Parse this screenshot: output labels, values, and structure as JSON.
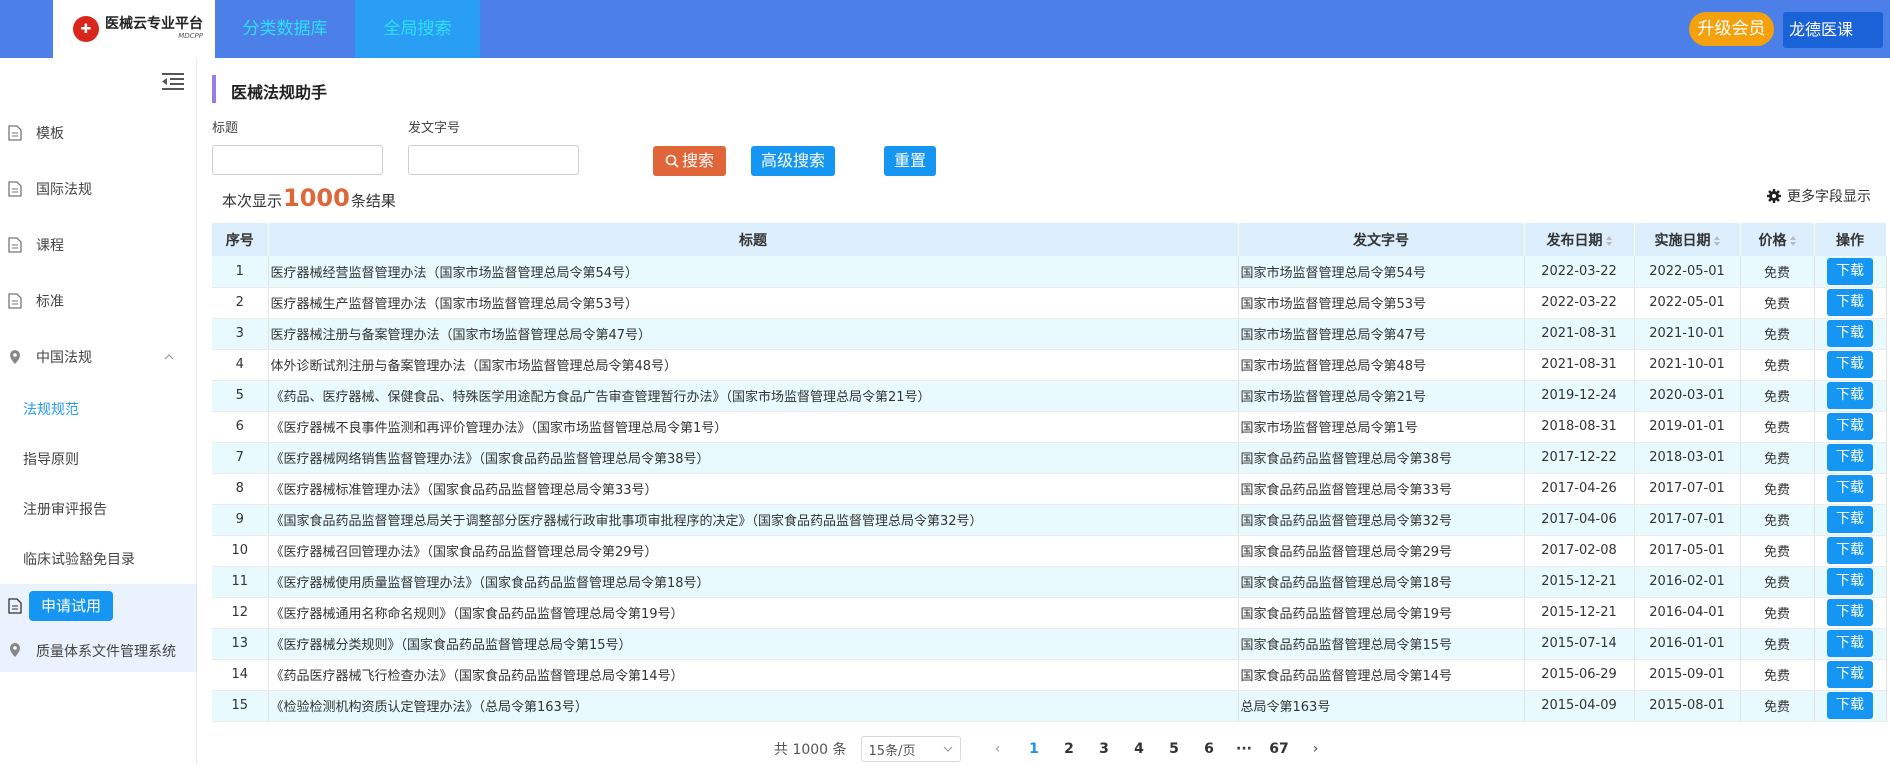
{
  "header": {
    "logo_title": "医械云专业平台",
    "logo_sub": "MDCPP",
    "tabs": [
      {
        "label": "分类数据库"
      },
      {
        "label": "全局搜索"
      }
    ],
    "upgrade_label": "升级会员",
    "user_name": "龙德医课",
    "colors": {
      "bar": "#4c7fe8",
      "tab_text": "#2ee0f6",
      "active_tab": "#2a9df4",
      "upgrade": "#f5a10d"
    }
  },
  "sidebar": {
    "items": [
      {
        "label": "模板",
        "icon": "document-icon"
      },
      {
        "label": "国际法规",
        "icon": "document-icon"
      },
      {
        "label": "课程",
        "icon": "document-icon"
      },
      {
        "label": "标准",
        "icon": "document-icon"
      },
      {
        "label": "中国法规",
        "icon": "location-pin-icon",
        "expanded": true
      }
    ],
    "sub_items": [
      {
        "label": "法规规范",
        "active": true
      },
      {
        "label": "指导原则"
      },
      {
        "label": "注册审评报告"
      },
      {
        "label": "临床试验豁免目录"
      }
    ],
    "apply_label": "申请试用",
    "qms_label": "质量体系文件管理系统"
  },
  "main": {
    "title": "医械法规助手",
    "filters": {
      "title_label": "标题",
      "title_value": "",
      "docno_label": "发文字号",
      "docno_value": ""
    },
    "buttons": {
      "search": "搜索",
      "advanced": "高级搜索",
      "reset": "重置"
    },
    "result_prefix": "本次显示",
    "result_count": "1000",
    "result_suffix": "条结果",
    "more_fields": "更多字段显示"
  },
  "table": {
    "columns": [
      "序号",
      "标题",
      "发文字号",
      "发布日期",
      "实施日期",
      "价格",
      "操作"
    ],
    "download_label": "下载",
    "rows": [
      {
        "no": "1",
        "title": "医疗器械经营监督管理办法（国家市场监督管理总局令第54号）",
        "docno": "国家市场监督管理总局令第54号",
        "pub": "2022-03-22",
        "eff": "2022-05-01",
        "price": "免费"
      },
      {
        "no": "2",
        "title": "医疗器械生产监督管理办法（国家市场监督管理总局令第53号）",
        "docno": "国家市场监督管理总局令第53号",
        "pub": "2022-03-22",
        "eff": "2022-05-01",
        "price": "免费"
      },
      {
        "no": "3",
        "title": "医疗器械注册与备案管理办法（国家市场监督管理总局令第47号）",
        "docno": "国家市场监督管理总局令第47号",
        "pub": "2021-08-31",
        "eff": "2021-10-01",
        "price": "免费"
      },
      {
        "no": "4",
        "title": "体外诊断试剂注册与备案管理办法（国家市场监督管理总局令第48号）",
        "docno": "国家市场监督管理总局令第48号",
        "pub": "2021-08-31",
        "eff": "2021-10-01",
        "price": "免费"
      },
      {
        "no": "5",
        "title": "《药品、医疗器械、保健食品、特殊医学用途配方食品广告审查管理暂行办法》（国家市场监督管理总局令第21号）",
        "docno": "国家市场监督管理总局令第21号",
        "pub": "2019-12-24",
        "eff": "2020-03-01",
        "price": "免费"
      },
      {
        "no": "6",
        "title": "《医疗器械不良事件监测和再评价管理办法》（国家市场监督管理总局令第1号）",
        "docno": "国家市场监督管理总局令第1号",
        "pub": "2018-08-31",
        "eff": "2019-01-01",
        "price": "免费"
      },
      {
        "no": "7",
        "title": "《医疗器械网络销售监督管理办法》（国家食品药品监督管理总局令第38号）",
        "docno": "国家食品药品监督管理总局令第38号",
        "pub": "2017-12-22",
        "eff": "2018-03-01",
        "price": "免费"
      },
      {
        "no": "8",
        "title": "《医疗器械标准管理办法》（国家食品药品监督管理总局令第33号）",
        "docno": "国家食品药品监督管理总局令第33号",
        "pub": "2017-04-26",
        "eff": "2017-07-01",
        "price": "免费"
      },
      {
        "no": "9",
        "title": "《国家食品药品监督管理总局关于调整部分医疗器械行政审批事项审批程序的决定》（国家食品药品监督管理总局令第32号）",
        "docno": "国家食品药品监督管理总局令第32号",
        "pub": "2017-04-06",
        "eff": "2017-07-01",
        "price": "免费"
      },
      {
        "no": "10",
        "title": "《医疗器械召回管理办法》（国家食品药品监督管理总局令第29号）",
        "docno": "国家食品药品监督管理总局令第29号",
        "pub": "2017-02-08",
        "eff": "2017-05-01",
        "price": "免费"
      },
      {
        "no": "11",
        "title": "《医疗器械使用质量监督管理办法》（国家食品药品监督管理总局令第18号）",
        "docno": "国家食品药品监督管理总局令第18号",
        "pub": "2015-12-21",
        "eff": "2016-02-01",
        "price": "免费"
      },
      {
        "no": "12",
        "title": "《医疗器械通用名称命名规则》（国家食品药品监督管理总局令第19号）",
        "docno": "国家食品药品监督管理总局令第19号",
        "pub": "2015-12-21",
        "eff": "2016-04-01",
        "price": "免费"
      },
      {
        "no": "13",
        "title": "《医疗器械分类规则》（国家食品药品监督管理总局令第15号）",
        "docno": "国家食品药品监督管理总局令第15号",
        "pub": "2015-07-14",
        "eff": "2016-01-01",
        "price": "免费"
      },
      {
        "no": "14",
        "title": "《药品医疗器械飞行检查办法》（国家食品药品监督管理总局令第14号）",
        "docno": "国家食品药品监督管理总局令第14号",
        "pub": "2015-06-29",
        "eff": "2015-09-01",
        "price": "免费"
      },
      {
        "no": "15",
        "title": "《检验检测机构资质认定管理办法》（总局令第163号）",
        "docno": "总局令第163号",
        "pub": "2015-04-09",
        "eff": "2015-08-01",
        "price": "免费"
      }
    ]
  },
  "pagination": {
    "total": "共 1000 条",
    "page_size": "15条/页",
    "pages": [
      "1",
      "2",
      "3",
      "4",
      "5",
      "6"
    ],
    "ellipsis": "···",
    "last_page": "67",
    "current": "1"
  }
}
